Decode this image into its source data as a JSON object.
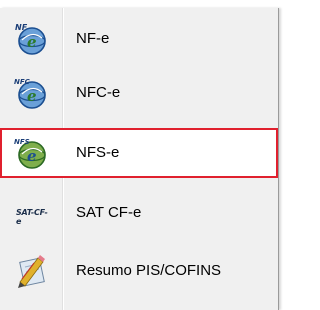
{
  "menu": {
    "items": [
      {
        "label": "NF-e",
        "icon": "nfe-globe-icon",
        "selected": false
      },
      {
        "label": "NFC-e",
        "icon": "nfce-globe-icon",
        "selected": false
      },
      {
        "label": "NFS-e",
        "icon": "nfse-globe-icon",
        "selected": true
      },
      {
        "label": "SAT CF-e",
        "icon": "sat-cfe-icon",
        "selected": false,
        "icon_text": "SAT-CF-e"
      },
      {
        "label": "Resumo PIS/COFINS",
        "icon": "pencil-document-icon",
        "selected": false
      }
    ]
  },
  "colors": {
    "menu_bg": "#f0f0f0",
    "highlight_border": "#e0202e",
    "text": "#000000"
  }
}
